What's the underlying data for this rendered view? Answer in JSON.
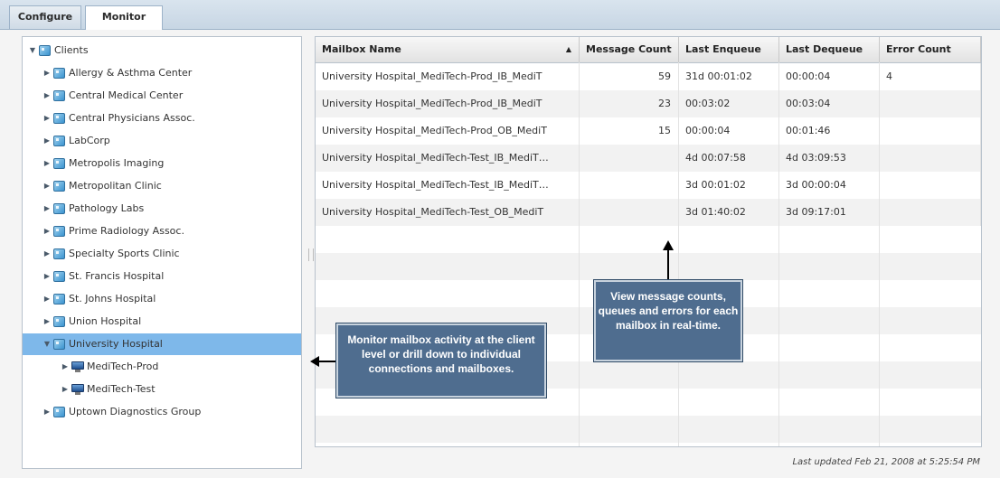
{
  "tabs": [
    {
      "label": "Configure",
      "active": false
    },
    {
      "label": "Monitor",
      "active": true
    }
  ],
  "tree": {
    "root": "Clients",
    "items": [
      {
        "label": "Allergy & Asthma Center",
        "level": 1,
        "expanded": false,
        "icon": "client-icon",
        "selected": false
      },
      {
        "label": "Central Medical Center",
        "level": 1,
        "expanded": false,
        "icon": "client-icon",
        "selected": false
      },
      {
        "label": "Central Physicians Assoc.",
        "level": 1,
        "expanded": false,
        "icon": "client-icon",
        "selected": false
      },
      {
        "label": "LabCorp",
        "level": 1,
        "expanded": false,
        "icon": "client-icon",
        "selected": false
      },
      {
        "label": "Metropolis Imaging",
        "level": 1,
        "expanded": false,
        "icon": "client-icon",
        "selected": false
      },
      {
        "label": "Metropolitan Clinic",
        "level": 1,
        "expanded": false,
        "icon": "client-icon",
        "selected": false
      },
      {
        "label": "Pathology Labs",
        "level": 1,
        "expanded": false,
        "icon": "client-icon",
        "selected": false
      },
      {
        "label": "Prime Radiology Assoc.",
        "level": 1,
        "expanded": false,
        "icon": "client-icon",
        "selected": false
      },
      {
        "label": "Specialty Sports Clinic",
        "level": 1,
        "expanded": false,
        "icon": "client-icon",
        "selected": false
      },
      {
        "label": "St. Francis Hospital",
        "level": 1,
        "expanded": false,
        "icon": "client-icon",
        "selected": false
      },
      {
        "label": "St. Johns Hospital",
        "level": 1,
        "expanded": false,
        "icon": "client-icon",
        "selected": false
      },
      {
        "label": "Union Hospital",
        "level": 1,
        "expanded": false,
        "icon": "client-icon",
        "selected": false
      },
      {
        "label": "University Hospital",
        "level": 1,
        "expanded": true,
        "icon": "client-icon",
        "selected": true
      },
      {
        "label": "MediTech-Prod",
        "level": 2,
        "expanded": false,
        "icon": "connection-icon",
        "selected": false
      },
      {
        "label": "MediTech-Test",
        "level": 2,
        "expanded": false,
        "icon": "connection-icon",
        "selected": false
      },
      {
        "label": "Uptown Diagnostics Group",
        "level": 1,
        "expanded": false,
        "icon": "client-icon",
        "selected": false
      }
    ]
  },
  "grid": {
    "columns": [
      "Mailbox Name",
      "Message Count",
      "Last Enqueue",
      "Last Dequeue",
      "Error Count"
    ],
    "sort_column": "Mailbox Name",
    "sort_direction": "ascending",
    "rows": [
      [
        "University Hospital_MediTech-Prod_IB_MediT",
        "59",
        "31d 00:01:02",
        "00:00:04",
        "4"
      ],
      [
        "University Hospital_MediTech-Prod_IB_MediT",
        "23",
        "00:03:02",
        "00:03:04",
        ""
      ],
      [
        "University Hospital_MediTech-Prod_OB_MediT",
        "15",
        "00:00:04",
        "00:01:46",
        ""
      ],
      [
        "University Hospital_MediTech-Test_IB_MediT…",
        "",
        "4d 00:07:58",
        "4d 03:09:53",
        ""
      ],
      [
        "University Hospital_MediTech-Test_IB_MediT…",
        "",
        "3d 00:01:02",
        "3d 00:00:04",
        ""
      ],
      [
        "University Hospital_MediTech-Test_OB_MediT",
        "",
        "3d 01:40:02",
        "3d 09:17:01",
        ""
      ]
    ],
    "empty_rows": 8
  },
  "footer": {
    "last_updated": "Last updated Feb 21, 2008 at 5:25:54 PM"
  },
  "callouts": {
    "tree": "Monitor mailbox activity at the client level or drill down to individual connections and mailboxes.",
    "grid": "View message counts, queues and errors for each mailbox in real-time."
  },
  "colors": {
    "selected_row": "#7eb8ea",
    "callout_bg": "#4f6d8f",
    "alt_row": "#f2f2f2"
  }
}
